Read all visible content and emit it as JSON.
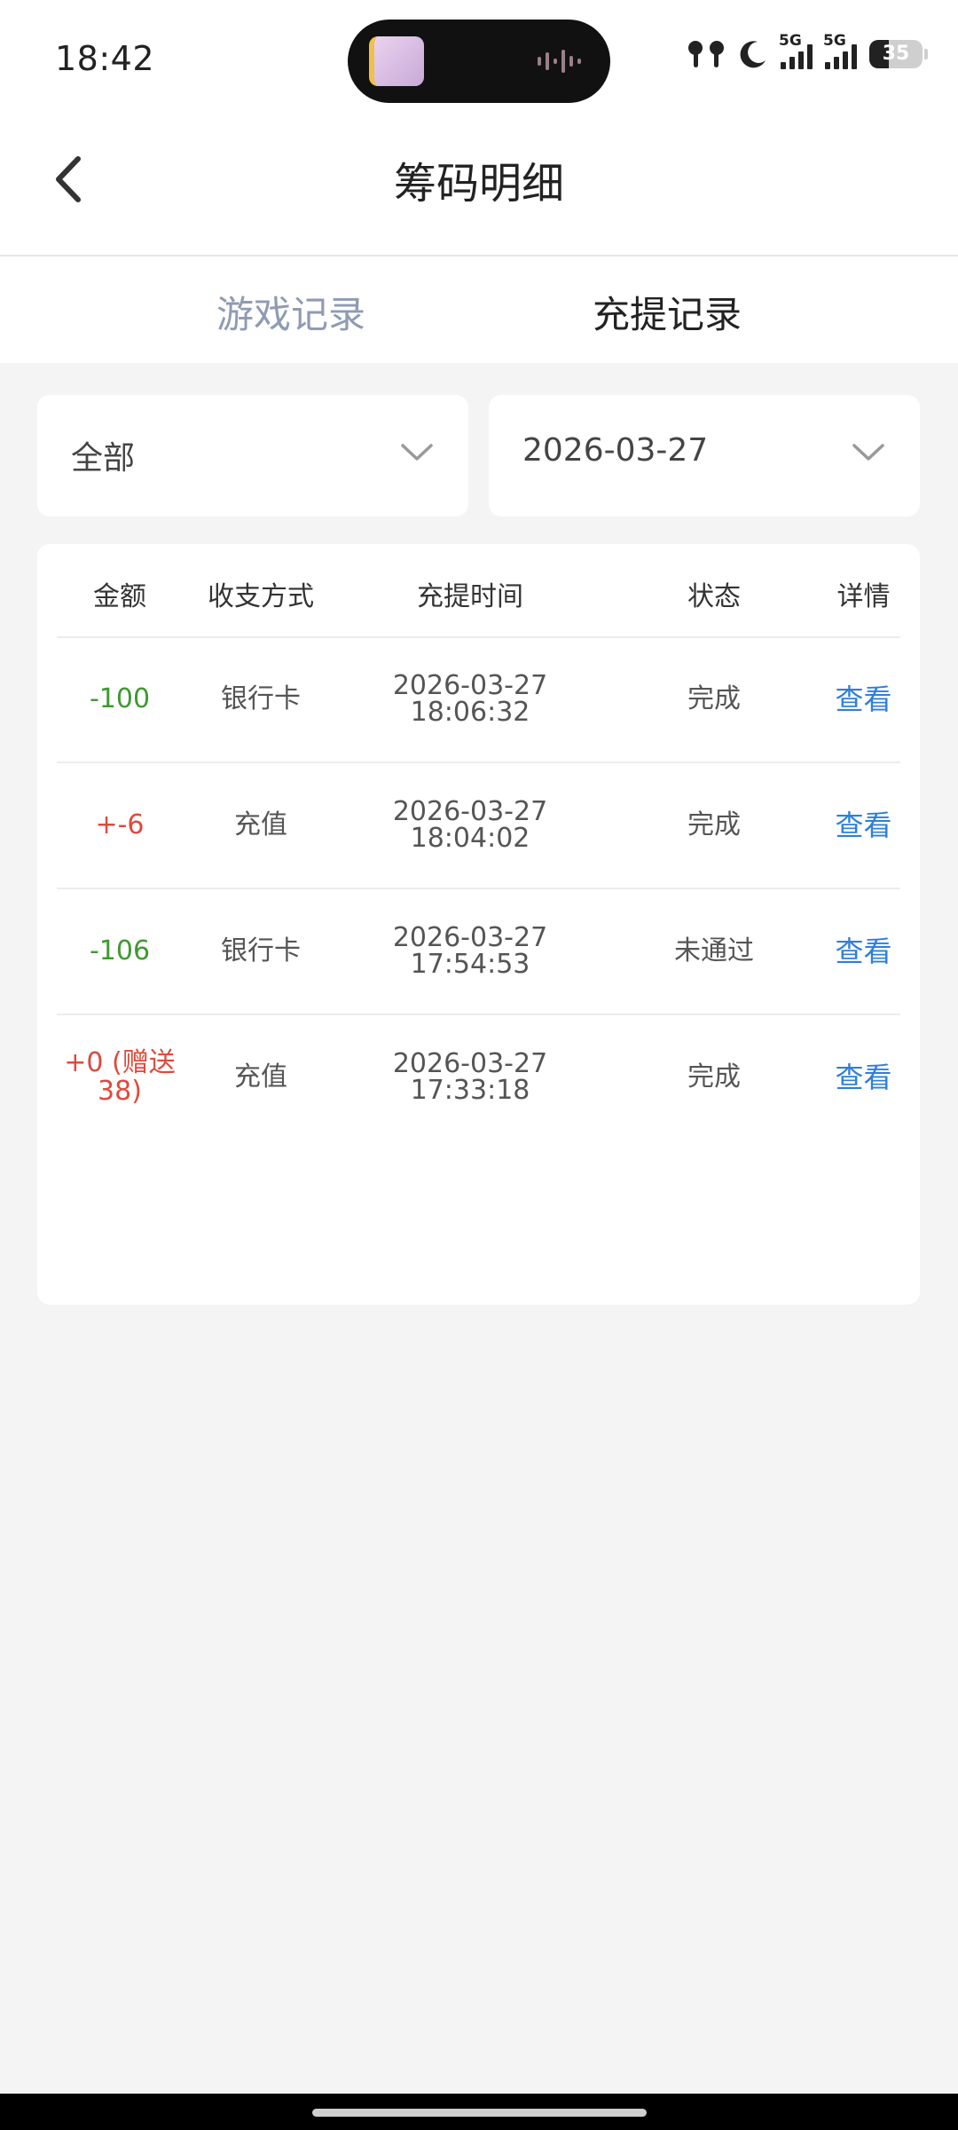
{
  "status_bar": {
    "time": "18:42",
    "signal1_label": "5G",
    "signal2_label": "5G",
    "battery": "35",
    "icons": [
      "earbuds-icon",
      "moon-icon",
      "signal-icon",
      "signal-icon",
      "battery-icon"
    ]
  },
  "header": {
    "title": "筹码明细",
    "back_icon": "chevron-left-icon"
  },
  "tabs": [
    {
      "label": "游戏记录",
      "active": false
    },
    {
      "label": "充提记录",
      "active": true
    }
  ],
  "filters": {
    "type_value": "全部",
    "date_value": "2026-03-27"
  },
  "table": {
    "headers": [
      "金额",
      "收支方式",
      "充提时间",
      "状态",
      "详情"
    ],
    "rows": [
      {
        "amount": "-100",
        "method": "银行卡",
        "date": "2026-03-27",
        "time": "18:06:32",
        "status": "完成",
        "action": "查看",
        "amount_color": "green"
      },
      {
        "amount": "+-6",
        "method": "充值",
        "date": "2026-03-27",
        "time": "18:04:02",
        "status": "完成",
        "action": "查看",
        "amount_color": "red"
      },
      {
        "amount": "-106",
        "method": "银行卡",
        "date": "2026-03-27",
        "time": "17:54:53",
        "status": "未通过",
        "action": "查看",
        "amount_color": "green"
      },
      {
        "amount": "+0 (赠送38)",
        "method": "充值",
        "date": "2026-03-27",
        "time": "17:33:18",
        "status": "完成",
        "action": "查看",
        "amount_color": "red"
      }
    ]
  },
  "colors": {
    "positive": "#de4a3c",
    "negative": "#3e9a2f",
    "link": "#2f7fd6",
    "inactive_tab": "#8e9bb3"
  }
}
